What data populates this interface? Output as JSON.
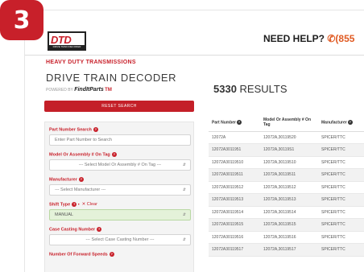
{
  "step": "3",
  "header": {
    "logo_text": "DTD",
    "logo_sub": "DRIVE TRAIN DECODER",
    "help_label": "NEED HELP?",
    "phone_icon": "phone-icon",
    "phone_partial": "(855"
  },
  "sidebar": {
    "brand_line": "HEAVY DUTY TRANSMISSIONS",
    "app_title": "DRIVE TRAIN DECODER",
    "powered_by": "POWERED BY",
    "powered_brand": "FindItParts",
    "powered_tm": "TM",
    "reset_label": "RESET SEARCH"
  },
  "filters": {
    "part_number": {
      "label": "Part Number Search",
      "placeholder": "Enter Part Number to Search"
    },
    "model": {
      "label": "Model Or Assembly # On Tag",
      "value": "--- Select Model Or Assembly # On Tag ---"
    },
    "manufacturer": {
      "label": "Manufacturer",
      "value": "--- Select Manufacturer ---"
    },
    "shift_type": {
      "label": "Shift Type",
      "clear_label": "Clear",
      "value": "MANUAL"
    },
    "case_casting": {
      "label": "Case Casting Number",
      "value": "--- Select Case Casting Number ---"
    },
    "forward_speeds": {
      "label": "Number Of Forward Speeds"
    }
  },
  "results": {
    "count": "5330",
    "count_label": "RESULTS",
    "columns": [
      "Part Number",
      "Model Or Assembly # On Tag",
      "Manufacturer"
    ],
    "rows": [
      [
        "12072A",
        "12072A,30119520",
        "SPICER/TTC"
      ],
      [
        "12072A3011951",
        "12072A,30119S1",
        "SPICER/TTC"
      ],
      [
        "12072A30119510",
        "12072A,30119510",
        "SPICER/TTC"
      ],
      [
        "12072A30119511",
        "12072A,30119511",
        "SPICER/TTC"
      ],
      [
        "12072A30119512",
        "12072A,30119512",
        "SPICER/TTC"
      ],
      [
        "12072A30119513",
        "12072A,30119513",
        "SPICER/TTC"
      ],
      [
        "12072A30119514",
        "12072A,30119514",
        "SPICER/TTC"
      ],
      [
        "12072A30119515",
        "12072A,30119515",
        "SPICER/TTC"
      ],
      [
        "12072A30119516",
        "12072A,30119516",
        "SPICER/TTC"
      ],
      [
        "12072A30119517",
        "12072A,30119517",
        "SPICER/TTC"
      ]
    ]
  },
  "colors": {
    "accent": "#c8202a",
    "phone": "#e05a22",
    "shift_selected_bg": "#e4f2d9"
  }
}
